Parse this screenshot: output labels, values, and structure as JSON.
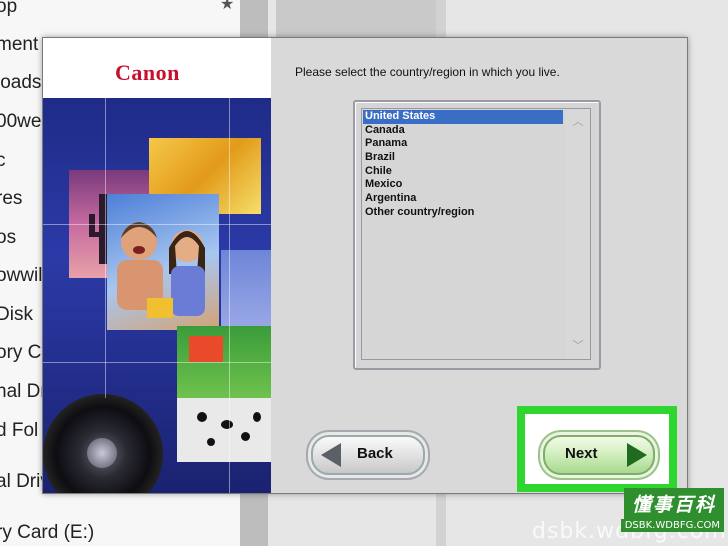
{
  "background_explorer": {
    "sidebar_items": [
      {
        "label": "op"
      },
      {
        "label": "ment"
      },
      {
        "label": "loads"
      },
      {
        "label": "00we"
      },
      {
        "label": "c"
      },
      {
        "label": "res"
      },
      {
        "label": "os"
      },
      {
        "label": "owwil"
      },
      {
        "label": " Disk"
      },
      {
        "label": "ory C"
      },
      {
        "label": "nal Dr"
      },
      {
        "label": "d Fol"
      },
      {
        "label": "al Driv"
      },
      {
        "label": "ry Card (E:)"
      }
    ]
  },
  "dialog": {
    "brand": "Canon",
    "prompt": "Please select the country/region in which you live.",
    "countries": [
      {
        "label": "United States",
        "selected": true
      },
      {
        "label": "Canada"
      },
      {
        "label": "Panama"
      },
      {
        "label": "Brazil"
      },
      {
        "label": "Chile"
      },
      {
        "label": "Mexico"
      },
      {
        "label": "Argentina"
      },
      {
        "label": "Other country/region"
      }
    ],
    "back_label": "Back",
    "next_label": "Next"
  },
  "watermark": {
    "cn": "懂事百科",
    "url_small": "DSBK.WDBFG.COM",
    "url_large": "dsbk.wdbfg.com"
  },
  "colors": {
    "highlight": "#2fd62f",
    "brand_red": "#c8102e",
    "selection": "#3a6ec4"
  }
}
